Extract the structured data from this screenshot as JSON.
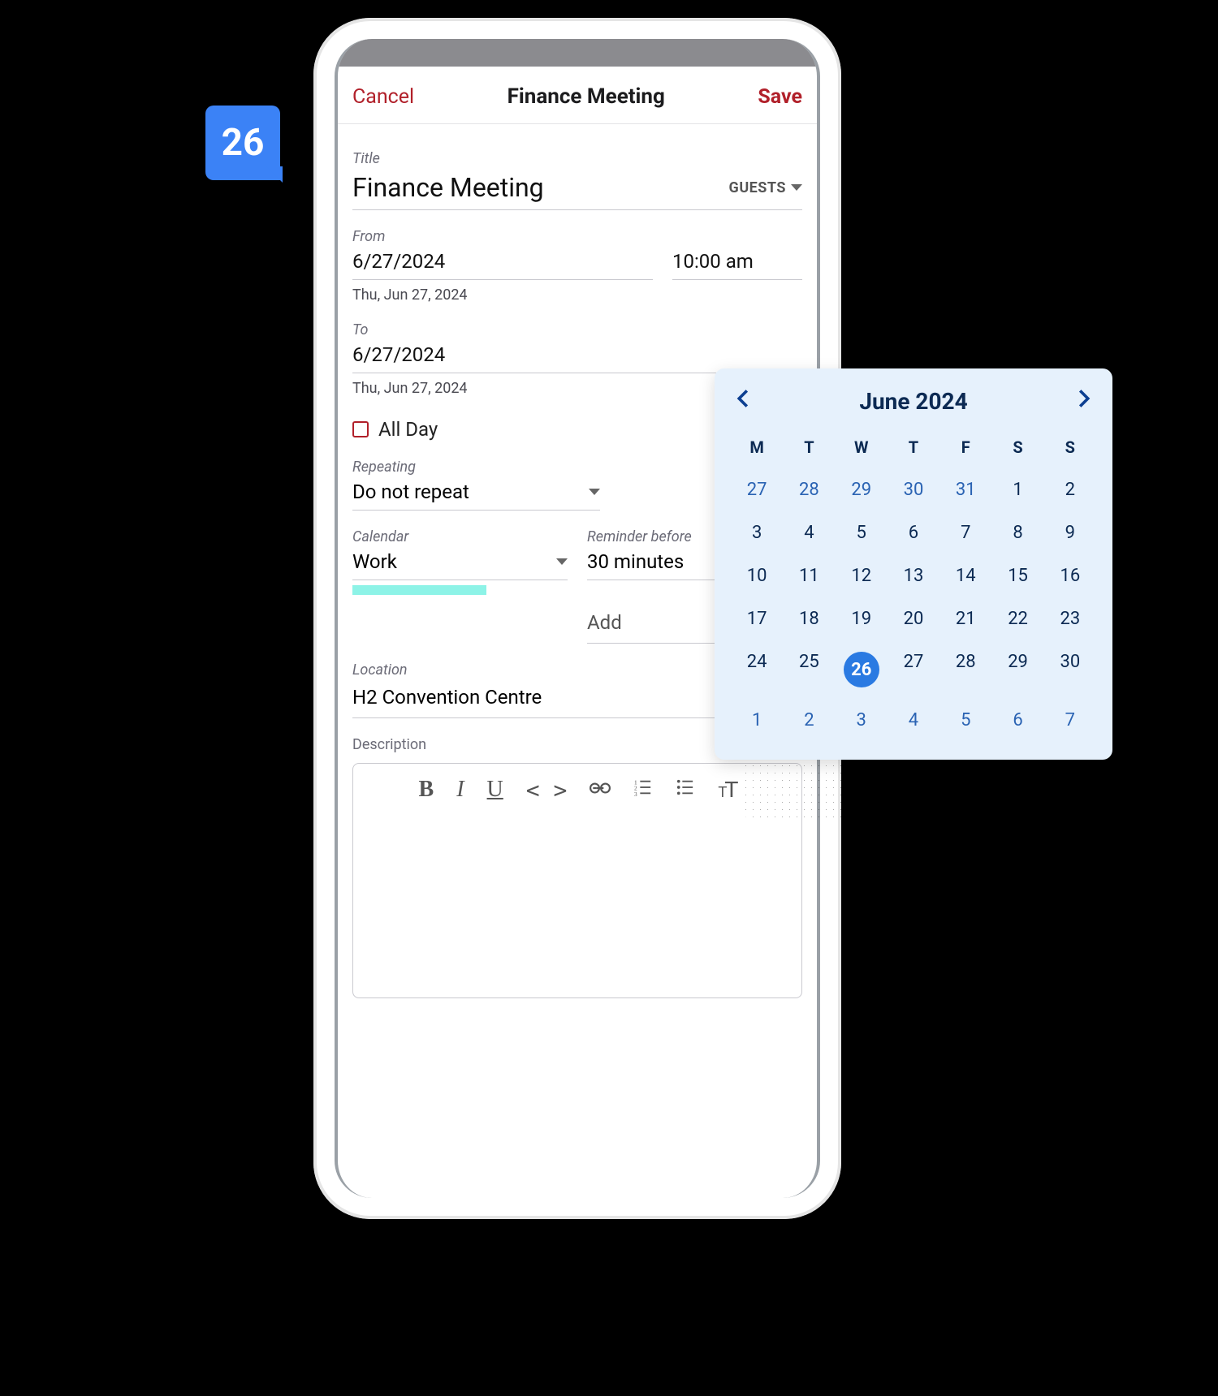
{
  "badge": {
    "number": "26"
  },
  "topbar": {
    "cancel": "Cancel",
    "title": "Finance Meeting",
    "save": "Save"
  },
  "event": {
    "title_label": "Title",
    "title": "Finance Meeting",
    "guests_button": "GUESTS",
    "from_label": "From",
    "from_date": "6/27/2024",
    "from_time": "10:00 am",
    "from_helper": "Thu, Jun 27, 2024",
    "to_label": "To",
    "to_date": "6/27/2024",
    "to_helper": "Thu, Jun 27, 2024",
    "all_day_label": "All Day",
    "repeating_label": "Repeating",
    "repeating_value": "Do not repeat",
    "calendar_label": "Calendar",
    "calendar_value": "Work",
    "reminder_label": "Reminder before",
    "reminder_value": "30 minutes",
    "add_placeholder": "Add",
    "location_label": "Location",
    "location_value": "H2 Convention Centre",
    "description_label": "Description"
  },
  "picker": {
    "month_label": "June 2024",
    "dow": [
      "M",
      "T",
      "W",
      "T",
      "F",
      "S",
      "S"
    ],
    "weeks": [
      [
        {
          "d": "27",
          "out": true
        },
        {
          "d": "28",
          "out": true
        },
        {
          "d": "29",
          "out": true
        },
        {
          "d": "30",
          "out": true
        },
        {
          "d": "31",
          "out": true
        },
        {
          "d": "1"
        },
        {
          "d": "2"
        }
      ],
      [
        {
          "d": "3"
        },
        {
          "d": "4"
        },
        {
          "d": "5"
        },
        {
          "d": "6"
        },
        {
          "d": "7"
        },
        {
          "d": "8"
        },
        {
          "d": "9"
        }
      ],
      [
        {
          "d": "10"
        },
        {
          "d": "11"
        },
        {
          "d": "12"
        },
        {
          "d": "13"
        },
        {
          "d": "14"
        },
        {
          "d": "15"
        },
        {
          "d": "16"
        }
      ],
      [
        {
          "d": "17"
        },
        {
          "d": "18"
        },
        {
          "d": "19"
        },
        {
          "d": "20"
        },
        {
          "d": "21"
        },
        {
          "d": "22"
        },
        {
          "d": "23"
        }
      ],
      [
        {
          "d": "24"
        },
        {
          "d": "25"
        },
        {
          "d": "26",
          "sel": true
        },
        {
          "d": "27"
        },
        {
          "d": "28"
        },
        {
          "d": "29"
        },
        {
          "d": "30"
        }
      ],
      [
        {
          "d": "1",
          "out": true
        },
        {
          "d": "2",
          "out": true
        },
        {
          "d": "3",
          "out": true
        },
        {
          "d": "4",
          "out": true
        },
        {
          "d": "5",
          "out": true
        },
        {
          "d": "6",
          "out": true
        },
        {
          "d": "7",
          "out": true
        }
      ]
    ]
  }
}
